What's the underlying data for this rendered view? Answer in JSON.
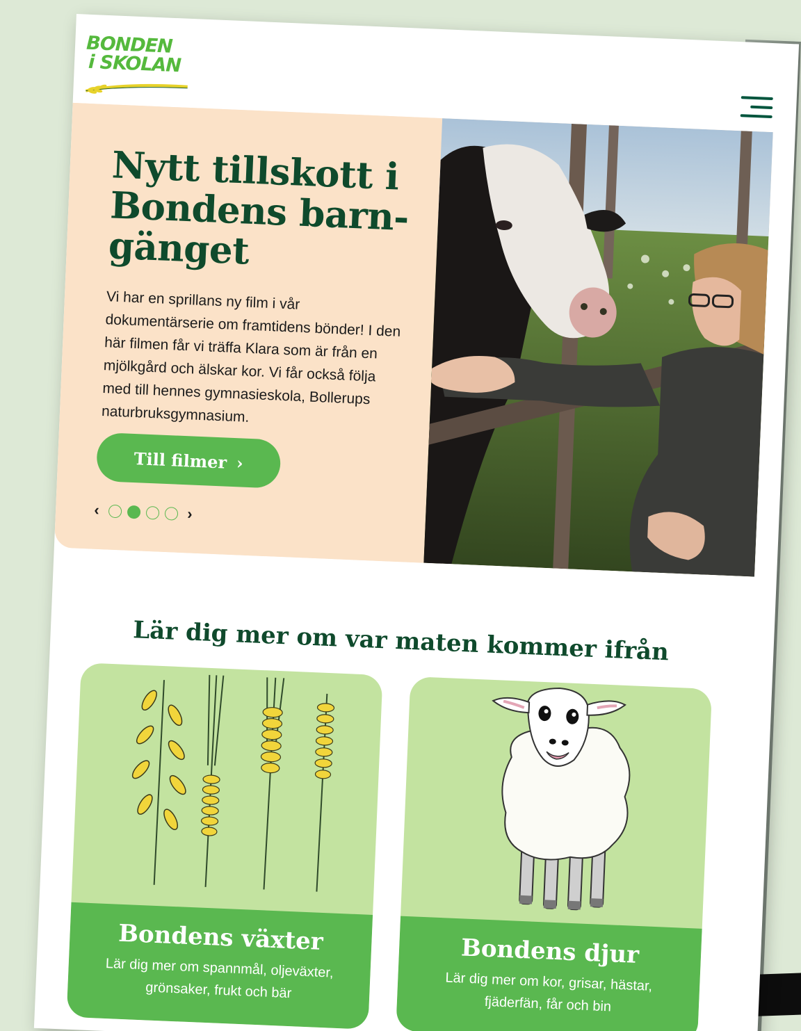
{
  "logo": {
    "line1": "BONDEN",
    "line2": "i SKOLAN"
  },
  "hero": {
    "title": "Nytt tillskott i Bondens barn-gänget",
    "body": "Vi har en sprillans ny film i vår dokumentärserie om framtidens bönder! I den här filmen får vi träffa Klara som är från en mjölkgård och älskar kor. Vi får också följa med till hennes gymnasieskola, Bollerups naturbruksgymnasium.",
    "button_label": "Till filmer",
    "button_chevron": "›",
    "prev": "‹",
    "next": "›",
    "slides_total": 4,
    "slide_active": 2
  },
  "section": {
    "title": "Lär dig mer om var maten kommer ifrån"
  },
  "cards": [
    {
      "title": "Bondens växter",
      "desc": "Lär dig mer om spannmål, oljeväxter, grönsaker, frukt och bär",
      "illustration": "grain-stalks"
    },
    {
      "title": "Bondens djur",
      "desc": "Lär dig mer om kor, grisar, hästar, fjäderfän, får och bin",
      "illustration": "sheep"
    }
  ],
  "colors": {
    "brand_green": "#5ab850",
    "dark_green": "#0f4a2c",
    "peach": "#fbe2c8",
    "light_green": "#c3e3a0"
  }
}
